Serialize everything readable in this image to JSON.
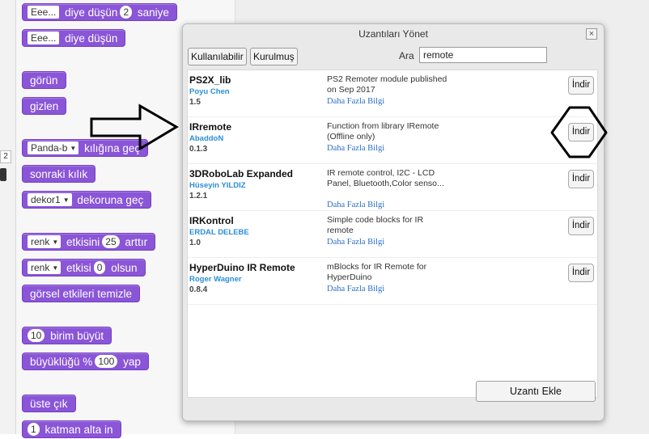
{
  "left_edge": {
    "number": "2"
  },
  "blocks": [
    {
      "parts": [
        {
          "type": "rect",
          "text": "Eee..."
        },
        {
          "type": "text",
          "text": "diye düşün"
        },
        {
          "type": "pill",
          "text": "2"
        },
        {
          "type": "text",
          "text": "saniye"
        }
      ]
    },
    {
      "parts": [
        {
          "type": "rect",
          "text": "Eee..."
        },
        {
          "type": "text",
          "text": "diye düşün"
        }
      ]
    },
    {
      "parts": [
        {
          "type": "text",
          "text": "görün"
        }
      ]
    },
    {
      "parts": [
        {
          "type": "text",
          "text": "gizlen"
        }
      ]
    },
    {
      "parts": [
        {
          "type": "dropdown",
          "text": "Panda-b"
        },
        {
          "type": "text",
          "text": "kılığına geç"
        }
      ]
    },
    {
      "parts": [
        {
          "type": "text",
          "text": "sonraki kılık"
        }
      ]
    },
    {
      "parts": [
        {
          "type": "dropdown",
          "text": "dekor1"
        },
        {
          "type": "text",
          "text": "dekoruna geç"
        }
      ]
    },
    {
      "parts": [
        {
          "type": "dropdown",
          "text": "renk"
        },
        {
          "type": "text",
          "text": "etkisini"
        },
        {
          "type": "pill",
          "text": "25"
        },
        {
          "type": "text",
          "text": "arttır"
        }
      ]
    },
    {
      "parts": [
        {
          "type": "dropdown",
          "text": "renk"
        },
        {
          "type": "text",
          "text": "etkisi"
        },
        {
          "type": "pill",
          "text": "0"
        },
        {
          "type": "text",
          "text": "olsun"
        }
      ]
    },
    {
      "parts": [
        {
          "type": "text",
          "text": "görsel etkileri temizle"
        }
      ]
    },
    {
      "parts": [
        {
          "type": "pill",
          "text": "10"
        },
        {
          "type": "text",
          "text": "birim büyüt"
        }
      ]
    },
    {
      "parts": [
        {
          "type": "text",
          "text": "büyüklüğü %"
        },
        {
          "type": "pill",
          "text": "100"
        },
        {
          "type": "text",
          "text": "yap"
        }
      ]
    },
    {
      "parts": [
        {
          "type": "text",
          "text": "üste çık"
        }
      ]
    },
    {
      "parts": [
        {
          "type": "pill",
          "text": "1"
        },
        {
          "type": "text",
          "text": "katman alta in"
        }
      ]
    }
  ],
  "dialog": {
    "title": "Uzantıları Yönet",
    "close_label": "×",
    "tabs": [
      {
        "label": "Kullanılabilir"
      },
      {
        "label": "Kurulmuş"
      }
    ],
    "search": {
      "label": "Ara",
      "value": "remote"
    },
    "extensions": [
      {
        "name": "PS2X_lib",
        "author": "Poyu Chen",
        "version": "1.5",
        "description": "PS2 Remoter module published on Sep 2017",
        "more": "Daha Fazla Bilgi",
        "download": "İndir"
      },
      {
        "name": "IRremote",
        "author": "AbaddoN",
        "version": "0.1.3",
        "description": "Function from library IRemote (Offline only)",
        "more": "Daha Fazla Bilgi",
        "download": "İndir"
      },
      {
        "name": "3DRoboLab Expanded",
        "author": "Hüseyin YILDIZ",
        "version": "1.2.1",
        "description": "IR remote control, I2C - LCD Panel, Bluetooth,Color senso...",
        "more": "Daha Fazla Bilgi",
        "download": "İndir"
      },
      {
        "name": "IRKontrol",
        "author": "ERDAL DELEBE",
        "version": "1.0",
        "description": "Simple code blocks for IR remote",
        "more": "Daha Fazla Bilgi",
        "download": "İndir"
      },
      {
        "name": "HyperDuino IR Remote",
        "author": "Roger Wagner",
        "version": "0.8.4",
        "description": "mBlocks for IR Remote for HyperDuino",
        "more": "Daha Fazla Bilgi",
        "download": "İndir"
      }
    ],
    "add_button": "Uzantı Ekle"
  },
  "colors": {
    "looks_block": "#8a55d7",
    "link": "#2b6fc4",
    "author": "#2b8ed8"
  }
}
